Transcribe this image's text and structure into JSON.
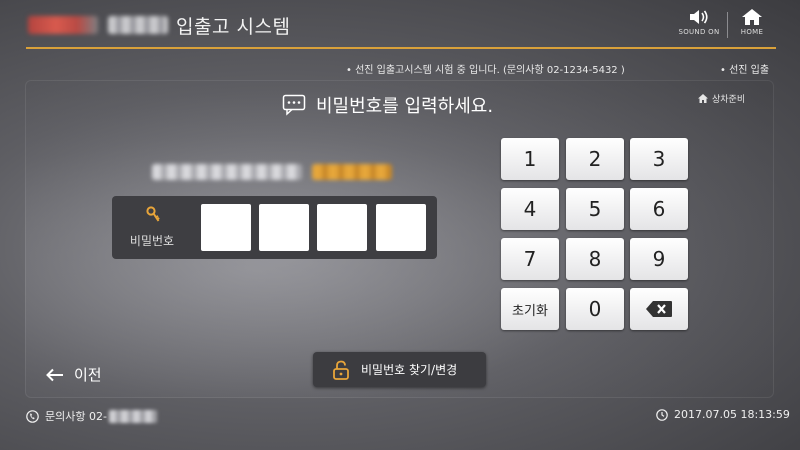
{
  "header": {
    "title": "입출고 시스템",
    "sound_label": "SOUND ON",
    "home_label": "HOME",
    "accent_color": "#d9a13a"
  },
  "notice": {
    "text": "• 선진 입출고시스템 시험 중 입니다. (문의사항 02-1234-5432 )",
    "text2": "• 선진 입출"
  },
  "main": {
    "prompt": "비밀번호를 입력하세요.",
    "breadcrumb": "상차준비",
    "pin_label": "비밀번호",
    "pin_digits": [
      "",
      "",
      "",
      ""
    ]
  },
  "keypad": {
    "keys": [
      "1",
      "2",
      "3",
      "4",
      "5",
      "6",
      "7",
      "8",
      "9",
      "초기화",
      "0",
      "backspace"
    ]
  },
  "controls": {
    "back_label": "이전",
    "find_password_label": "비밀번호 찾기/변경"
  },
  "footer": {
    "contact_label": "문의사항 02-",
    "datetime": "2017.07.05 18:13:59"
  },
  "icons": [
    "speaker-icon",
    "home-icon",
    "chat-icon",
    "home-small-icon",
    "key-icon",
    "backspace-icon",
    "back-arrow-icon",
    "lock-icon",
    "phone-icon",
    "clock-icon"
  ]
}
